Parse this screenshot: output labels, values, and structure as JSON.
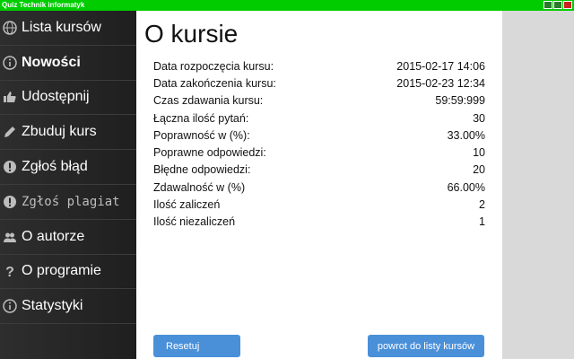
{
  "window": {
    "title": "Quiz Technik informatyk"
  },
  "sidebar": {
    "items": [
      {
        "label": "Lista kursów",
        "icon": "globe-icon"
      },
      {
        "label": "Nowości",
        "icon": "info-icon"
      },
      {
        "label": "Udostępnij",
        "icon": "thumbs-up-icon"
      },
      {
        "label": "Zbuduj kurs",
        "icon": "pencil-icon"
      },
      {
        "label": "Zgłoś błąd",
        "icon": "alert-icon"
      },
      {
        "label": "Zgłoś plagiat",
        "icon": "alert-icon"
      },
      {
        "label": "O autorze",
        "icon": "users-icon"
      },
      {
        "label": "O programie",
        "icon": "question-icon"
      },
      {
        "label": "Statystyki",
        "icon": "info-icon"
      }
    ]
  },
  "main": {
    "title": "O kursie",
    "stats": [
      {
        "label": "Data rozpoczęcia kursu:",
        "value": "2015-02-17 14:06"
      },
      {
        "label": "Data zakończenia kursu:",
        "value": "2015-02-23 12:34"
      },
      {
        "label": "Czas zdawania kursu:",
        "value": "59:59:999"
      },
      {
        "label": "Łączna ilość pytań:",
        "value": "30"
      },
      {
        "label": "Poprawność w (%):",
        "value": "33.00%"
      },
      {
        "label": "Poprawne odpowiedzi:",
        "value": "10"
      },
      {
        "label": "Błędne odpowiedzi:",
        "value": "20"
      },
      {
        "label": "Zdawalność w (%)",
        "value": "66.00%"
      },
      {
        "label": "Ilość zaliczeń",
        "value": "2"
      },
      {
        "label": "Ilość niezaliczeń",
        "value": "1"
      }
    ],
    "reset_label": "Resetuj",
    "back_label": "powrot do listy kursów"
  },
  "colors": {
    "titlebar": "#00cc00",
    "sidebar": "#262626",
    "button": "#4a90d9"
  }
}
